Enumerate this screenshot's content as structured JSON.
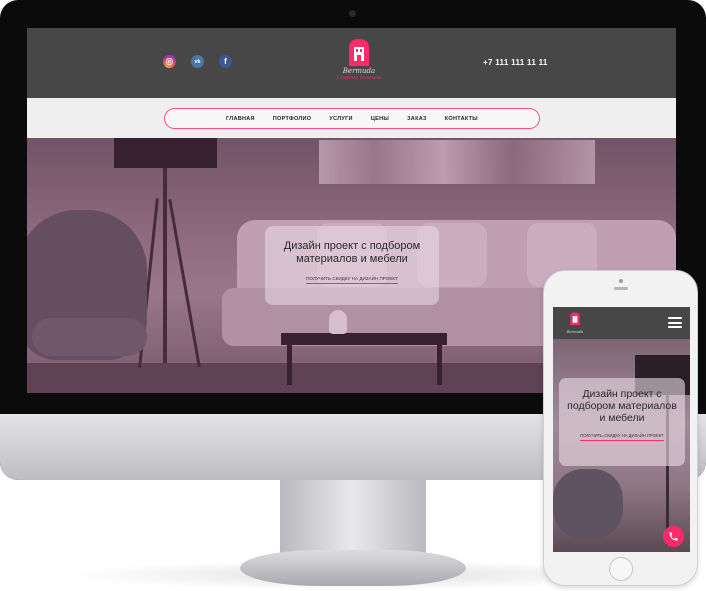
{
  "desktop": {
    "header": {
      "socials": [
        {
          "icon": "instagram-icon",
          "label": ""
        },
        {
          "icon": "vk-icon",
          "label": "vk"
        },
        {
          "icon": "facebook-icon",
          "label": "f"
        }
      ],
      "logo_name": "Bermuda",
      "logo_tagline": "Студия дизайна",
      "phone": "+7 111 111 11 11"
    },
    "nav": {
      "items": [
        "ГЛАВНАЯ",
        "ПОРТФОЛИО",
        "УСЛУГИ",
        "ЦЕНЫ",
        "ЗАКАЗ",
        "КОНТАКТЫ"
      ]
    },
    "hero": {
      "title": "Дизайн проект с подбором материалов и мебели",
      "cta": "ПОЛУЧИТЬ СКИДКУ НА ДИЗАЙН ПРОЕКТ"
    }
  },
  "mobile": {
    "logo_name": "Bermuda",
    "hero": {
      "title": "Дизайн проект с подбором материалов и мебели",
      "cta": "ПОЛУЧИТЬ СКИДКУ НА ДИЗАЙН ПРОЕКТ"
    }
  },
  "colors": {
    "accent": "#ff2a6b",
    "header_bg": "#474747",
    "nav_bg": "#efefef"
  }
}
